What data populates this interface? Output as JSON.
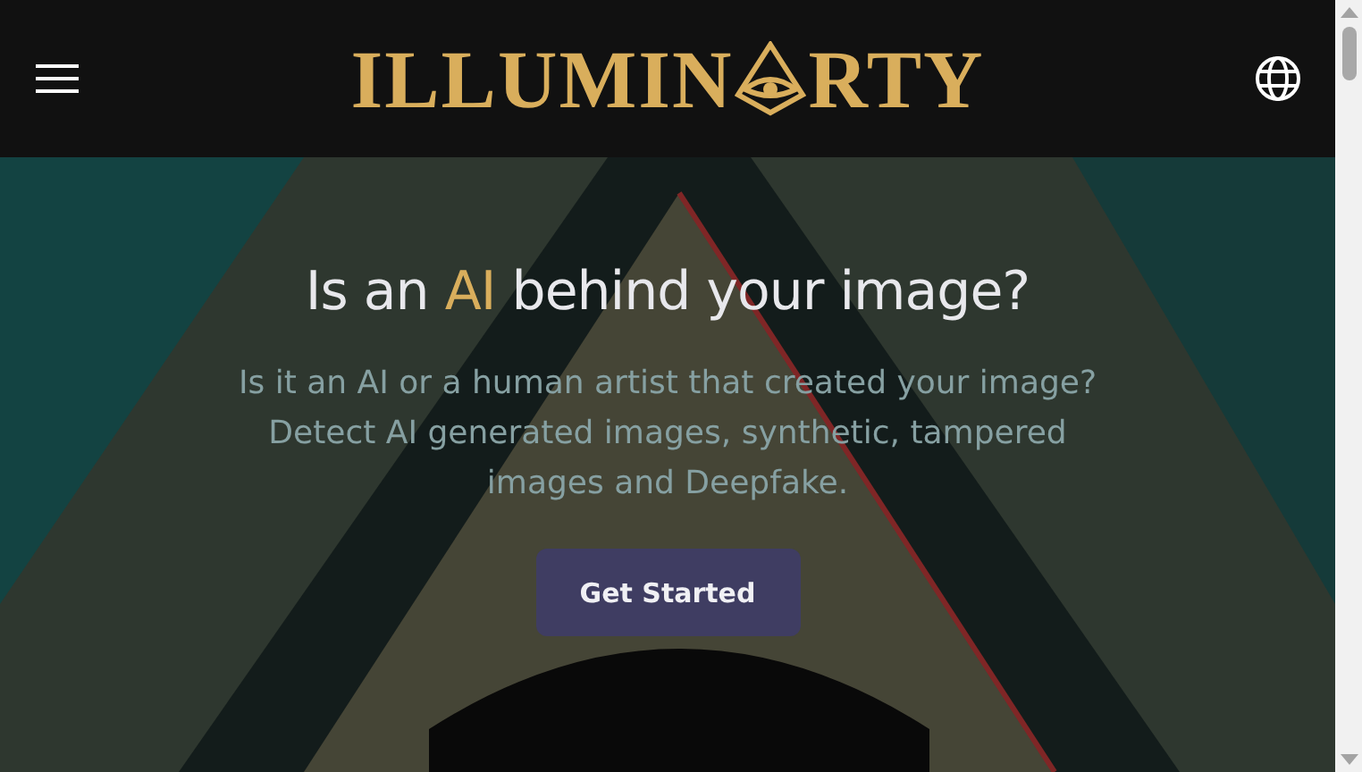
{
  "header": {
    "logo": {
      "before": "ILLUMIN",
      "after": "RTY"
    }
  },
  "hero": {
    "heading": {
      "before": "Is an ",
      "highlight": "AI",
      "after": " behind your image?"
    },
    "description": "Is it an AI or a human artist that created your image? Detect AI generated images, synthetic, tampered images and Deepfake.",
    "button": "Get Started"
  }
}
